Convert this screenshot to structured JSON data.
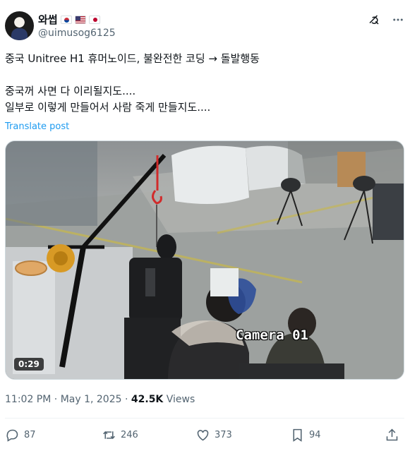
{
  "author": {
    "display_name": "와썹",
    "flags": [
      "kr-flag",
      "us-flag",
      "jp-flag"
    ],
    "handle": "@uimusog6125"
  },
  "header_icons": [
    "grok-icon",
    "more-icon"
  ],
  "tweet": {
    "lines": [
      "중국 Unitree H1 휴머노이드, 불완전한 코딩 → 돌발행동",
      "",
      "중국꺼 사면 다 이리될지도....",
      "일부로 이렇게 만들어서 사람 죽게 만들지도...."
    ],
    "translate_label": "Translate post"
  },
  "media": {
    "overlay_text": "Camera 01",
    "duration": "0:29"
  },
  "meta": {
    "time": "11:02 PM",
    "separator": "·",
    "date": "May 1, 2025",
    "views_count": "42.5K",
    "views_label": "Views"
  },
  "actions": {
    "replies": "87",
    "reposts": "246",
    "likes": "373",
    "bookmarks": "94"
  }
}
